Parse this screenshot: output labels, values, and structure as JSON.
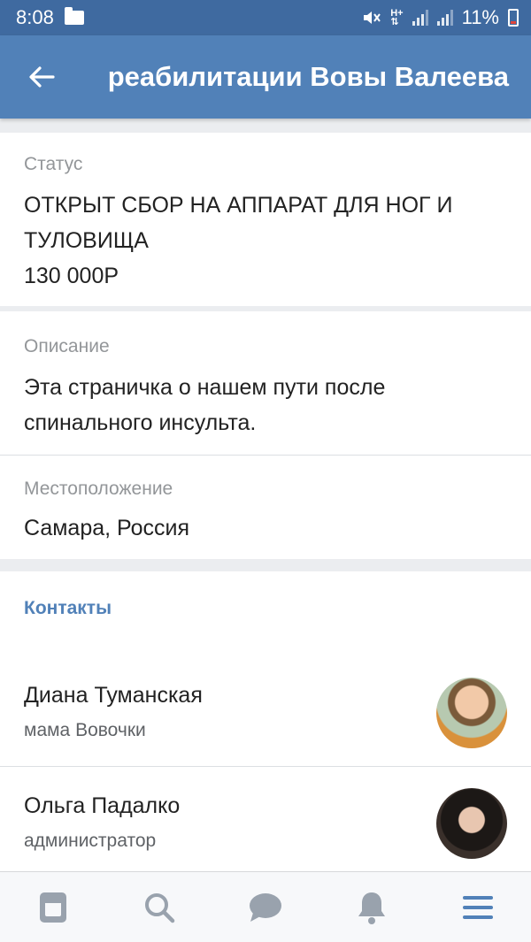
{
  "status_bar": {
    "time": "8:08",
    "battery": "11%"
  },
  "app_bar": {
    "title": "реабилитации Вовы Валеева"
  },
  "status_card": {
    "label": "Статус",
    "line1": "ОТКРЫТ СБОР НА АППАРАТ ДЛЯ НОГ И",
    "line2": "ТУЛОВИЩА",
    "line3": "130 000Р"
  },
  "description": {
    "label": "Описание",
    "line1": "Эта страничка о нашем пути после",
    "line2": "спинального инсульта."
  },
  "location": {
    "label": "Местоположение",
    "value": "Самара, Россия"
  },
  "contacts": {
    "title": "Контакты",
    "items": [
      {
        "name": "Диана Туманская",
        "role": "мама Вовочки"
      },
      {
        "name": "Ольга Падалко",
        "role": "администратор"
      }
    ]
  },
  "tabs": [
    {
      "icon": "news-icon"
    },
    {
      "icon": "search-icon"
    },
    {
      "icon": "messages-icon"
    },
    {
      "icon": "notifications-icon"
    },
    {
      "icon": "menu-icon"
    }
  ],
  "colors": {
    "accent": "#5181b8",
    "status_bar": "#3f6aa0",
    "tab_icon": "#99a2ad",
    "active_tab": "#5181b8"
  }
}
